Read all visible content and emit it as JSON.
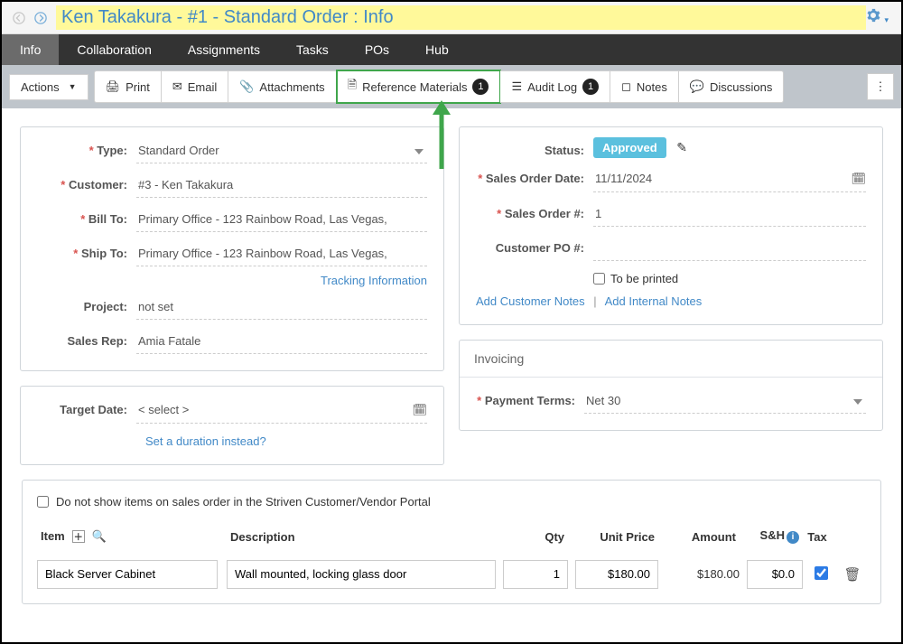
{
  "header": {
    "title": "Ken Takakura - #1 - Standard Order : Info"
  },
  "tabs": {
    "info": "Info",
    "collaboration": "Collaboration",
    "assignments": "Assignments",
    "tasks": "Tasks",
    "pos": "POs",
    "hub": "Hub"
  },
  "toolbar": {
    "actions": "Actions",
    "print": "Print",
    "email": "Email",
    "attachments": "Attachments",
    "reference_materials": "Reference Materials",
    "reference_badge": "1",
    "audit_log": "Audit Log",
    "audit_badge": "1",
    "notes": "Notes",
    "discussions": "Discussions"
  },
  "form": {
    "type_label": "Type:",
    "type_value": "Standard Order",
    "customer_label": "Customer:",
    "customer_value": "#3 - Ken Takakura",
    "billto_label": "Bill To:",
    "billto_value": "Primary Office - 123 Rainbow Road, Las Vegas,",
    "shipto_label": "Ship To:",
    "shipto_value": "Primary Office - 123 Rainbow Road, Las Vegas,",
    "tracking_link": "Tracking Information",
    "project_label": "Project:",
    "project_value": "not set",
    "salesrep_label": "Sales Rep:",
    "salesrep_value": "Amia Fatale",
    "target_date_label": "Target Date:",
    "target_date_value": "< select >",
    "duration_link": "Set a duration instead?"
  },
  "right": {
    "status_label": "Status:",
    "status_value": "Approved",
    "date_label": "Sales Order Date:",
    "date_value": "11/11/2024",
    "ordernum_label": "Sales Order #:",
    "ordernum_value": "1",
    "cpo_label": "Customer PO #:",
    "tobeprinted": "To be printed",
    "add_customer_notes": "Add Customer Notes",
    "add_internal_notes": "Add Internal Notes",
    "invoicing_title": "Invoicing",
    "payment_terms_label": "Payment Terms:",
    "payment_terms_value": "Net 30"
  },
  "items": {
    "portal_checkbox": "Do not show items on sales order in the Striven Customer/Vendor Portal",
    "head_item": "Item",
    "head_desc": "Description",
    "head_qty": "Qty",
    "head_price": "Unit Price",
    "head_amount": "Amount",
    "head_sh": "S&H",
    "head_tax": "Tax",
    "row1": {
      "item": "Black Server Cabinet",
      "desc": "Wall mounted, locking glass door",
      "qty": "1",
      "price": "$180.00",
      "amount": "$180.00",
      "sh": "$0.0"
    }
  }
}
